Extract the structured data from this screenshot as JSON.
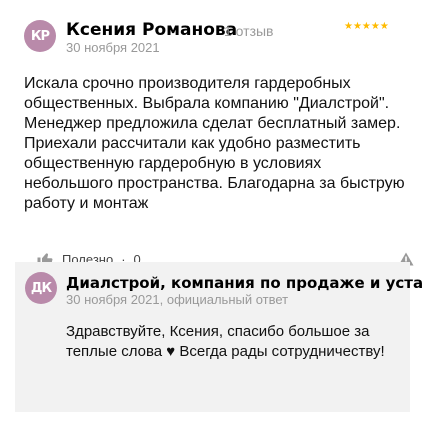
{
  "review": {
    "avatar_initials": "КР",
    "author": "Ксения Романова",
    "reviews_count": "1 отзыв",
    "stars": "★★★★★",
    "date": "30 ноября 2021",
    "text": "Искала срочно производителя гардеробных общественных. Выбрала компанию \"Диалстрой\". Менеджер предложила сделат бесплатный замер. Приехали рассчитали как удобно разместить общественную гардеробную в условиях небольшого пространства. Благодарна за быструю работу и монтаж",
    "useful_label": "Полезно",
    "useful_separator": "·",
    "useful_count": "0"
  },
  "reply": {
    "avatar_initials": "ДК",
    "company": "Диалстрой, компания по продаже и уста...",
    "meta": "30 ноября 2021, официальный ответ",
    "text": "Здравствуйте, Ксения, спасибо большое за теплые слова ♥ Всегда рады сотрудничеству!"
  },
  "colors": {
    "avatar": "#b98aaa",
    "stars": "#ffbb00",
    "reply_background": "#f2f2f2"
  },
  "icons": [
    "thumbs-up-icon",
    "warning-icon"
  ]
}
